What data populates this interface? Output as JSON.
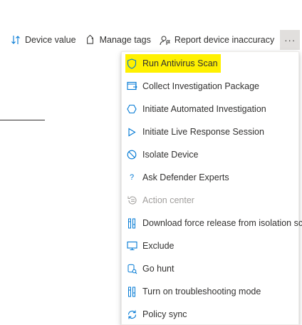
{
  "toolbar": {
    "device_value_label": "Device value",
    "manage_tags_label": "Manage tags",
    "report_inaccuracy_label": "Report device inaccuracy",
    "more_label": "···"
  },
  "menu": {
    "items": [
      {
        "label": "Run Antivirus Scan",
        "icon": "shield-icon",
        "highlighted": true,
        "disabled": false
      },
      {
        "label": "Collect Investigation Package",
        "icon": "package-icon",
        "disabled": false
      },
      {
        "label": "Initiate Automated Investigation",
        "icon": "hexagon-icon",
        "disabled": false
      },
      {
        "label": "Initiate Live Response Session",
        "icon": "play-icon",
        "disabled": false
      },
      {
        "label": "Isolate Device",
        "icon": "block-icon",
        "disabled": false
      },
      {
        "label": "Ask Defender Experts",
        "icon": "question-icon",
        "disabled": false
      },
      {
        "label": "Action center",
        "icon": "history-icon",
        "disabled": true
      },
      {
        "label": "Download force release from isolation script",
        "icon": "script-icon",
        "disabled": false
      },
      {
        "label": "Exclude",
        "icon": "monitor-icon",
        "disabled": false
      },
      {
        "label": "Go hunt",
        "icon": "hunt-icon",
        "disabled": false
      },
      {
        "label": "Turn on troubleshooting mode",
        "icon": "troubleshoot-icon",
        "disabled": false
      },
      {
        "label": "Policy sync",
        "icon": "sync-icon",
        "disabled": false
      }
    ]
  },
  "colors": {
    "accent": "#0078d4",
    "highlight": "#fff100",
    "text": "#323130",
    "disabled": "#a19f9d"
  }
}
